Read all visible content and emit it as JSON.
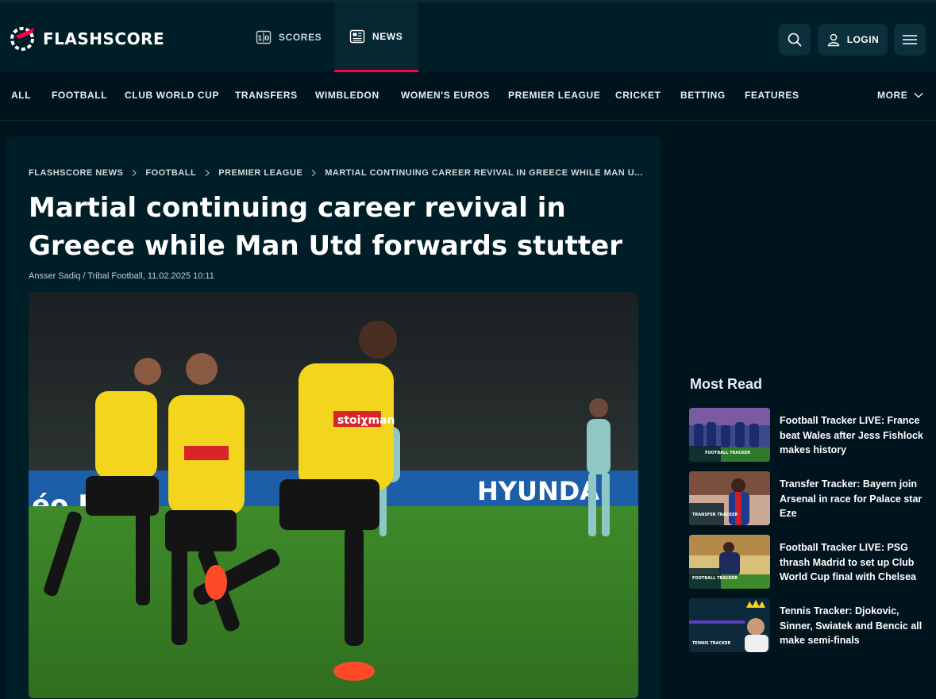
{
  "header": {
    "logo_text": "FLASHSCORE",
    "tabs": [
      {
        "label": "SCORES",
        "icon": "scores-icon",
        "active": false
      },
      {
        "label": "NEWS",
        "icon": "news-icon",
        "active": true
      }
    ],
    "login_label": "LOGIN",
    "accent_color": "#ff0046"
  },
  "nav": {
    "items": [
      "ALL",
      "FOOTBALL",
      "CLUB WORLD CUP",
      "TRANSFERS",
      "WIMBLEDON",
      "WOMEN'S EUROS",
      "PREMIER LEAGUE",
      "CRICKET",
      "BETTING",
      "FEATURES"
    ],
    "more_label": "MORE"
  },
  "article": {
    "breadcrumb": [
      "FLASHSCORE NEWS",
      "FOOTBALL",
      "PREMIER LEAGUE",
      "MARTIAL CONTINUING CAREER REVIVAL IN GREECE WHILE MAN U..."
    ],
    "title": "Martial continuing career revival in Greece while Man Utd forwards stutter",
    "author": "Ansser Sadiq / Tribal Football,",
    "date": "11.02.2025 10:11",
    "hero_sponsor_text": "stoiχman",
    "hero_board_text": "HYUNDAI",
    "hero_board_text2": "éo H"
  },
  "most_read": {
    "title": "Most Read",
    "items": [
      {
        "title": "Football Tracker LIVE: France beat Wales after Jess Fishlock makes history",
        "badge": "FOOTBALL TRACKER"
      },
      {
        "title": "Transfer Tracker: Bayern join Arsenal in race for Palace star Eze",
        "badge": "TRANSFER TRACKER"
      },
      {
        "title": "Football Tracker LIVE: PSG thrash Madrid to set up Club World Cup final with Chelsea",
        "badge": "FOOTBALL TRACKER"
      },
      {
        "title": "Tennis Tracker: Djokovic, Sinner, Swiatek and Bencic all make semi-finals",
        "badge": "TENNIS TRACKER"
      }
    ]
  }
}
